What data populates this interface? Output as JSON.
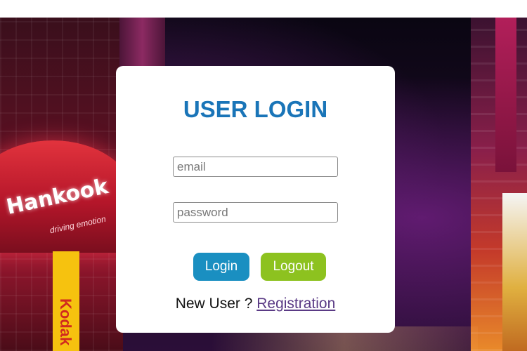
{
  "login_card": {
    "title": "USER LOGIN",
    "email_placeholder": "email",
    "password_placeholder": "password",
    "login_label": "Login",
    "logout_label": "Logout",
    "new_user_text": "New User ?",
    "registration_link": "Registration"
  },
  "background": {
    "sign_text": "Hankook",
    "sign_subtext": "driving emotion",
    "vertical_sign": "Kodak"
  },
  "colors": {
    "title": "#1a75b8",
    "login_button": "#1a8fc1",
    "logout_button": "#8dc21f",
    "link": "#5a3a85"
  }
}
